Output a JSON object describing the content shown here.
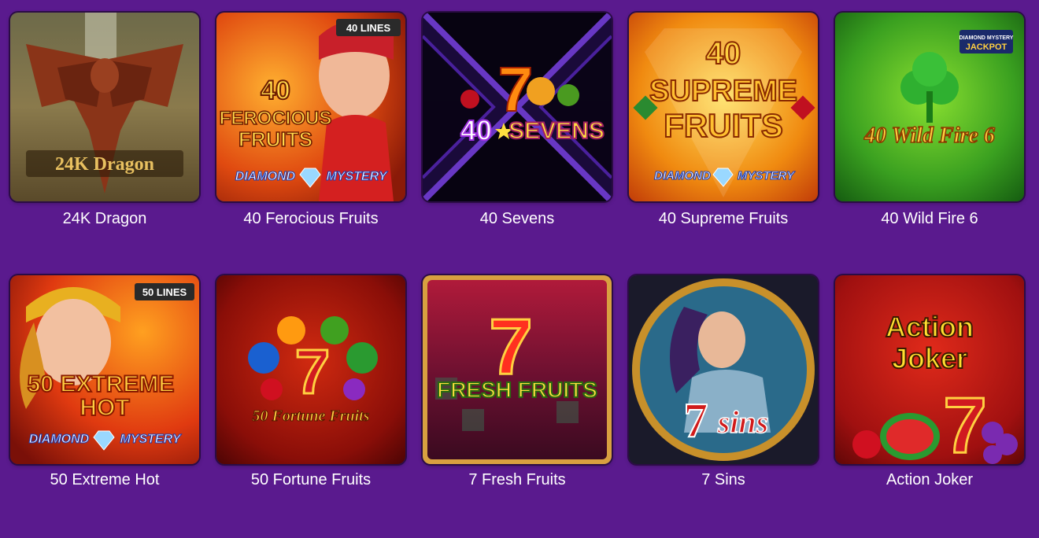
{
  "games": [
    {
      "name": "24K Dragon",
      "art_text": "24K Dragon"
    },
    {
      "name": "40 Ferocious Fruits",
      "badge": "40 LINES",
      "art_text": [
        "40",
        "FEROCIOUS",
        "FRUITS"
      ],
      "sub": "DIAMOND",
      "sub2": "MYSTERY"
    },
    {
      "name": "40 Sevens",
      "art_text": [
        "7",
        "40",
        "SEVENS"
      ]
    },
    {
      "name": "40 Supreme Fruits",
      "art_text": [
        "40",
        "SUPREME",
        "FRUITS"
      ],
      "sub": "DIAMOND",
      "sub2": "MYSTERY"
    },
    {
      "name": "40 Wild Fire 6",
      "art_text": "40 Wild Fire 6",
      "badge": [
        "DIAMOND MYSTERY",
        "JACKPOT"
      ]
    },
    {
      "name": "50 Extreme Hot",
      "badge": "50 LINES",
      "art_text": [
        "50 EXTREME",
        "HOT"
      ],
      "sub": "DIAMOND",
      "sub2": "MYSTERY"
    },
    {
      "name": "50 Fortune Fruits",
      "art_text": [
        "7",
        "50 Fortune Fruits"
      ]
    },
    {
      "name": "7 Fresh Fruits",
      "art_text": [
        "7",
        "FRESH FRUITS"
      ]
    },
    {
      "name": "7 Sins",
      "art_text": [
        "7",
        "sins"
      ]
    },
    {
      "name": "Action Joker",
      "art_text": [
        "Action",
        "Joker",
        "7"
      ]
    }
  ]
}
